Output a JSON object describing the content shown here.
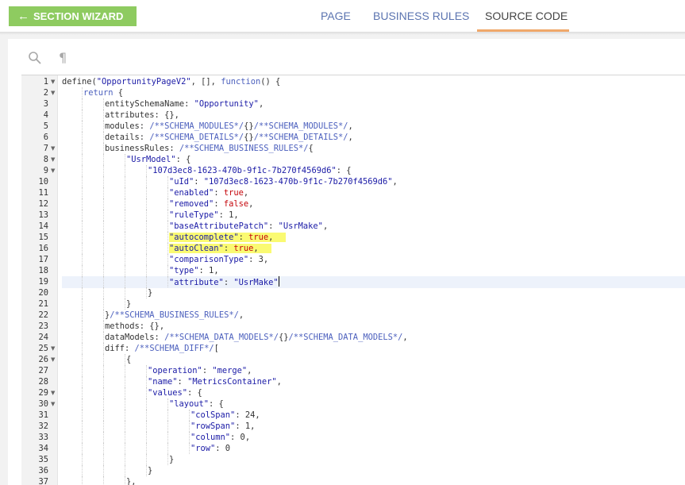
{
  "header": {
    "wizard_button": "SECTION WIZARD",
    "tabs": [
      {
        "label": "PAGE",
        "active": false
      },
      {
        "label": "BUSINESS RULES",
        "active": false
      },
      {
        "label": "SOURCE CODE",
        "active": true
      }
    ]
  },
  "toolbar": {
    "icons": [
      "search-icon",
      "pilcrow-icon"
    ],
    "pilcrow_glyph": "¶"
  },
  "colors": {
    "wizard_button": "#8ecb60",
    "tab_link": "#5b74b0",
    "active_tab_underline": "#f0a86a",
    "highlight": "#fafa72",
    "active_line": "#edf2fb"
  },
  "editor": {
    "cursor_line": 19,
    "highlighted_lines": [
      15,
      16
    ],
    "lines": [
      {
        "num": 1,
        "fold": true,
        "indent": 0,
        "tokens": [
          [
            "p",
            "define("
          ],
          [
            "s",
            "\"OpportunityPageV2\""
          ],
          [
            "p",
            ", [], "
          ],
          [
            "k",
            "function"
          ],
          [
            "p",
            "() {"
          ]
        ]
      },
      {
        "num": 2,
        "fold": true,
        "indent": 1,
        "tokens": [
          [
            "k",
            "return"
          ],
          [
            "p",
            " {"
          ]
        ]
      },
      {
        "num": 3,
        "fold": false,
        "indent": 2,
        "tokens": [
          [
            "p",
            "entitySchemaName: "
          ],
          [
            "s",
            "\"Opportunity\""
          ],
          [
            "p",
            ","
          ]
        ]
      },
      {
        "num": 4,
        "fold": false,
        "indent": 2,
        "tokens": [
          [
            "p",
            "attributes: {},"
          ]
        ]
      },
      {
        "num": 5,
        "fold": false,
        "indent": 2,
        "tokens": [
          [
            "p",
            "modules: "
          ],
          [
            "c",
            "/**SCHEMA_MODULES*/"
          ],
          [
            "p",
            "{}"
          ],
          [
            "c",
            "/**SCHEMA_MODULES*/"
          ],
          [
            "p",
            ","
          ]
        ]
      },
      {
        "num": 6,
        "fold": false,
        "indent": 2,
        "tokens": [
          [
            "p",
            "details: "
          ],
          [
            "c",
            "/**SCHEMA_DETAILS*/"
          ],
          [
            "p",
            "{}"
          ],
          [
            "c",
            "/**SCHEMA_DETAILS*/"
          ],
          [
            "p",
            ","
          ]
        ]
      },
      {
        "num": 7,
        "fold": true,
        "indent": 2,
        "tokens": [
          [
            "p",
            "businessRules: "
          ],
          [
            "c",
            "/**SCHEMA_BUSINESS_RULES*/"
          ],
          [
            "p",
            "{"
          ]
        ]
      },
      {
        "num": 8,
        "fold": true,
        "indent": 3,
        "tokens": [
          [
            "s",
            "\"UsrModel\""
          ],
          [
            "p",
            ": {"
          ]
        ]
      },
      {
        "num": 9,
        "fold": true,
        "indent": 4,
        "tokens": [
          [
            "s",
            "\"107d3ec8-1623-470b-9f1c-7b270f4569d6\""
          ],
          [
            "p",
            ": {"
          ]
        ]
      },
      {
        "num": 10,
        "fold": false,
        "indent": 5,
        "tokens": [
          [
            "s",
            "\"uId\""
          ],
          [
            "p",
            ": "
          ],
          [
            "s",
            "\"107d3ec8-1623-470b-9f1c-7b270f4569d6\""
          ],
          [
            "p",
            ","
          ]
        ]
      },
      {
        "num": 11,
        "fold": false,
        "indent": 5,
        "tokens": [
          [
            "s",
            "\"enabled\""
          ],
          [
            "p",
            ": "
          ],
          [
            "b",
            "true"
          ],
          [
            "p",
            ","
          ]
        ]
      },
      {
        "num": 12,
        "fold": false,
        "indent": 5,
        "tokens": [
          [
            "s",
            "\"removed\""
          ],
          [
            "p",
            ": "
          ],
          [
            "b",
            "false"
          ],
          [
            "p",
            ","
          ]
        ]
      },
      {
        "num": 13,
        "fold": false,
        "indent": 5,
        "tokens": [
          [
            "s",
            "\"ruleType\""
          ],
          [
            "p",
            ": 1,"
          ]
        ]
      },
      {
        "num": 14,
        "fold": false,
        "indent": 5,
        "tokens": [
          [
            "s",
            "\"baseAttributePatch\""
          ],
          [
            "p",
            ": "
          ],
          [
            "s",
            "\"UsrMake\""
          ],
          [
            "p",
            ","
          ]
        ]
      },
      {
        "num": 15,
        "fold": false,
        "indent": 5,
        "tokens": [
          [
            "s",
            "\"autocomplete\""
          ],
          [
            "p",
            ": "
          ],
          [
            "b",
            "true"
          ],
          [
            "p",
            ","
          ]
        ]
      },
      {
        "num": 16,
        "fold": false,
        "indent": 5,
        "tokens": [
          [
            "s",
            "\"autoClean\""
          ],
          [
            "p",
            ": "
          ],
          [
            "b",
            "true"
          ],
          [
            "p",
            ","
          ]
        ]
      },
      {
        "num": 17,
        "fold": false,
        "indent": 5,
        "tokens": [
          [
            "s",
            "\"comparisonType\""
          ],
          [
            "p",
            ": 3,"
          ]
        ]
      },
      {
        "num": 18,
        "fold": false,
        "indent": 5,
        "tokens": [
          [
            "s",
            "\"type\""
          ],
          [
            "p",
            ": 1,"
          ]
        ]
      },
      {
        "num": 19,
        "fold": false,
        "indent": 5,
        "tokens": [
          [
            "s",
            "\"attribute\""
          ],
          [
            "p",
            ": "
          ],
          [
            "s",
            "\"UsrMake\""
          ]
        ]
      },
      {
        "num": 20,
        "fold": false,
        "indent": 4,
        "tokens": [
          [
            "p",
            "}"
          ]
        ]
      },
      {
        "num": 21,
        "fold": false,
        "indent": 3,
        "tokens": [
          [
            "p",
            "}"
          ]
        ]
      },
      {
        "num": 22,
        "fold": false,
        "indent": 2,
        "tokens": [
          [
            "p",
            "}"
          ],
          [
            "c",
            "/**SCHEMA_BUSINESS_RULES*/"
          ],
          [
            "p",
            ","
          ]
        ]
      },
      {
        "num": 23,
        "fold": false,
        "indent": 2,
        "tokens": [
          [
            "p",
            "methods: {},"
          ]
        ]
      },
      {
        "num": 24,
        "fold": false,
        "indent": 2,
        "tokens": [
          [
            "p",
            "dataModels: "
          ],
          [
            "c",
            "/**SCHEMA_DATA_MODELS*/"
          ],
          [
            "p",
            "{}"
          ],
          [
            "c",
            "/**SCHEMA_DATA_MODELS*/"
          ],
          [
            "p",
            ","
          ]
        ]
      },
      {
        "num": 25,
        "fold": true,
        "indent": 2,
        "tokens": [
          [
            "p",
            "diff: "
          ],
          [
            "c",
            "/**SCHEMA_DIFF*/"
          ],
          [
            "p",
            "["
          ]
        ]
      },
      {
        "num": 26,
        "fold": true,
        "indent": 3,
        "tokens": [
          [
            "p",
            "{"
          ]
        ]
      },
      {
        "num": 27,
        "fold": false,
        "indent": 4,
        "tokens": [
          [
            "s",
            "\"operation\""
          ],
          [
            "p",
            ": "
          ],
          [
            "s",
            "\"merge\""
          ],
          [
            "p",
            ","
          ]
        ]
      },
      {
        "num": 28,
        "fold": false,
        "indent": 4,
        "tokens": [
          [
            "s",
            "\"name\""
          ],
          [
            "p",
            ": "
          ],
          [
            "s",
            "\"MetricsContainer\""
          ],
          [
            "p",
            ","
          ]
        ]
      },
      {
        "num": 29,
        "fold": true,
        "indent": 4,
        "tokens": [
          [
            "s",
            "\"values\""
          ],
          [
            "p",
            ": {"
          ]
        ]
      },
      {
        "num": 30,
        "fold": true,
        "indent": 5,
        "tokens": [
          [
            "s",
            "\"layout\""
          ],
          [
            "p",
            ": {"
          ]
        ]
      },
      {
        "num": 31,
        "fold": false,
        "indent": 6,
        "tokens": [
          [
            "s",
            "\"colSpan\""
          ],
          [
            "p",
            ": 24,"
          ]
        ]
      },
      {
        "num": 32,
        "fold": false,
        "indent": 6,
        "tokens": [
          [
            "s",
            "\"rowSpan\""
          ],
          [
            "p",
            ": 1,"
          ]
        ]
      },
      {
        "num": 33,
        "fold": false,
        "indent": 6,
        "tokens": [
          [
            "s",
            "\"column\""
          ],
          [
            "p",
            ": 0,"
          ]
        ]
      },
      {
        "num": 34,
        "fold": false,
        "indent": 6,
        "tokens": [
          [
            "s",
            "\"row\""
          ],
          [
            "p",
            ": 0"
          ]
        ]
      },
      {
        "num": 35,
        "fold": false,
        "indent": 5,
        "tokens": [
          [
            "p",
            "}"
          ]
        ]
      },
      {
        "num": 36,
        "fold": false,
        "indent": 4,
        "tokens": [
          [
            "p",
            "}"
          ]
        ]
      },
      {
        "num": 37,
        "fold": false,
        "indent": 3,
        "tokens": [
          [
            "p",
            "},"
          ]
        ]
      }
    ]
  }
}
